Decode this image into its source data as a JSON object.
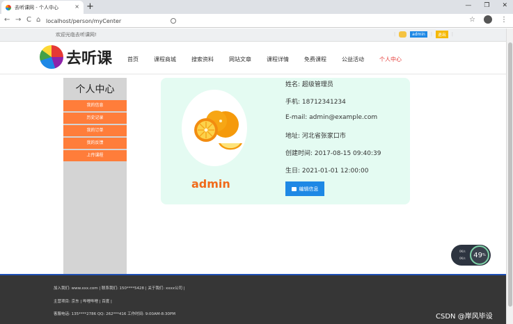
{
  "browser": {
    "tab_title": "去听课网 - 个人中心",
    "tab_close": "×",
    "new_tab": "+",
    "url": "localhost/person/myCenter",
    "back": "←",
    "forward": "→",
    "reload": "C",
    "home": "⌂",
    "star": "☆",
    "menu": "⋮",
    "window_controls": [
      "—",
      "❐",
      "✕"
    ]
  },
  "topbar": {
    "welcome": "欢迎光临去听课网!",
    "user": "admin",
    "exit": "退出"
  },
  "header": {
    "logo_text": "去听课",
    "nav": [
      "首页",
      "课程商城",
      "搜索资料",
      "网站文章",
      "课程详情",
      "免费课程",
      "公益活动",
      "个人中心"
    ]
  },
  "sidebar": {
    "title": "个人中心",
    "items": [
      "我的信息",
      "历史记录",
      "我的订单",
      "我的反馈",
      "上传课程"
    ]
  },
  "profile": {
    "username": "admin",
    "name_label": "姓名: 超级管理员",
    "phone_label": "手机: 18712341234",
    "email_label": "E-mail: admin@example.com",
    "address_label": "地址: 河北省张家口市",
    "created_label": "创建时间: 2017-08-15 09:40:39",
    "birthday_label": "生日: 2021-01-01 12:00:00",
    "edit_button": "编辑信息"
  },
  "footer": {
    "row1": "加入我们: www.xxx.com  |  联系我们: 150****5428  |  关于我们: xxxx公司  |",
    "row2": "主营项目: 京东  |  哔哩哔哩  |  百度  |",
    "row3": "客服电话: 135****2786 QQ: 262***416 工作时间: 9:00AM-8:30PM"
  },
  "widget": {
    "value": "49",
    "unit": "%",
    "up": "0K/s",
    "down": "0K/s"
  },
  "watermark": "CSDN @岸风毕设"
}
